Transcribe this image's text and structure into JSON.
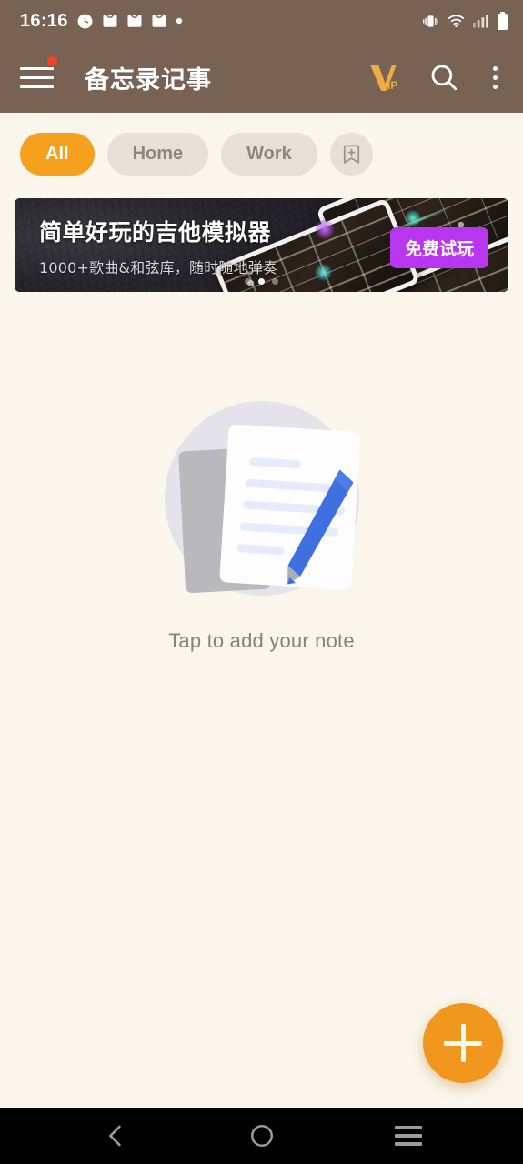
{
  "status_bar": {
    "time": "16:16",
    "left_icons": [
      "alarm-clock-icon",
      "mail-icon",
      "mail-icon",
      "mail-icon",
      "dot-indicator-icon"
    ],
    "right_icons": [
      "vibrate-icon",
      "wifi-icon",
      "cellular-signal-icon",
      "battery-icon"
    ]
  },
  "app_bar": {
    "title": "备忘录记事",
    "menu_icon": "hamburger-menu-icon",
    "menu_badge": true,
    "vip_label": "IP",
    "vip_icon": "vip-crown-icon",
    "search_icon": "search-icon",
    "overflow_icon": "overflow-menu-icon"
  },
  "filters": {
    "chips": [
      {
        "label": "All",
        "active": true
      },
      {
        "label": "Home",
        "active": false
      },
      {
        "label": "Work",
        "active": false
      }
    ],
    "add_category_icon": "bookmark-plus-icon"
  },
  "ad": {
    "title": "简单好玩的吉他模拟器",
    "subtitle": "1000+歌曲&和弦库，随时随地弹奏",
    "cta_label": "免费试玩",
    "dots": 3,
    "active_dot": 1
  },
  "empty_state": {
    "text": "Tap to add your note",
    "illustration": "note-and-pencil-illustration"
  },
  "fab": {
    "icon": "plus-icon",
    "label": "Add note"
  },
  "nav_bar": {
    "back": "back-icon",
    "home": "home-icon",
    "recents": "recents-icon"
  },
  "colors": {
    "app_bar": "#786253",
    "background": "#faf6ec",
    "accent_orange": "#f5a11e",
    "fab_orange": "#f2971d",
    "chip_inactive": "#e6e0d7",
    "chip_inactive_text": "#8d867e",
    "empty_text": "#8a8279",
    "badge_red": "#f0412b",
    "cta_purple": "#b936f0",
    "nav_bar": "#000000"
  }
}
